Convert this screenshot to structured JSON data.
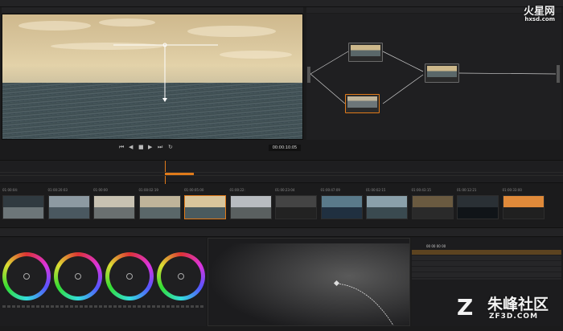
{
  "viewer": {
    "timecode": "00:00:10:05"
  },
  "watermark": {
    "logo_top_text": "火星网",
    "logo_top_url": "hxsd.com",
    "logo_bottom_text": "朱峰社区",
    "logo_bottom_url": "ZF3D.COM"
  },
  "clips": [
    {
      "tc": "01:00:04:"
    },
    {
      "tc": "01:00:20:03"
    },
    {
      "tc": "01:00:00"
    },
    {
      "tc": "01:00:02:19"
    },
    {
      "tc": "01:00:05:00"
    },
    {
      "tc": "01:00:22:"
    },
    {
      "tc": "01:00:23:04"
    },
    {
      "tc": "01:00:47:09"
    },
    {
      "tc": "01:00:02:15"
    },
    {
      "tc": "01:00:43:15"
    },
    {
      "tc": "01:00:12:21"
    },
    {
      "tc": "01:00:33:00"
    }
  ],
  "layers": {
    "timecode": "00 00 00 00"
  },
  "colors": {
    "accent": "#e07a1a",
    "bg": "#1b1b1c"
  }
}
